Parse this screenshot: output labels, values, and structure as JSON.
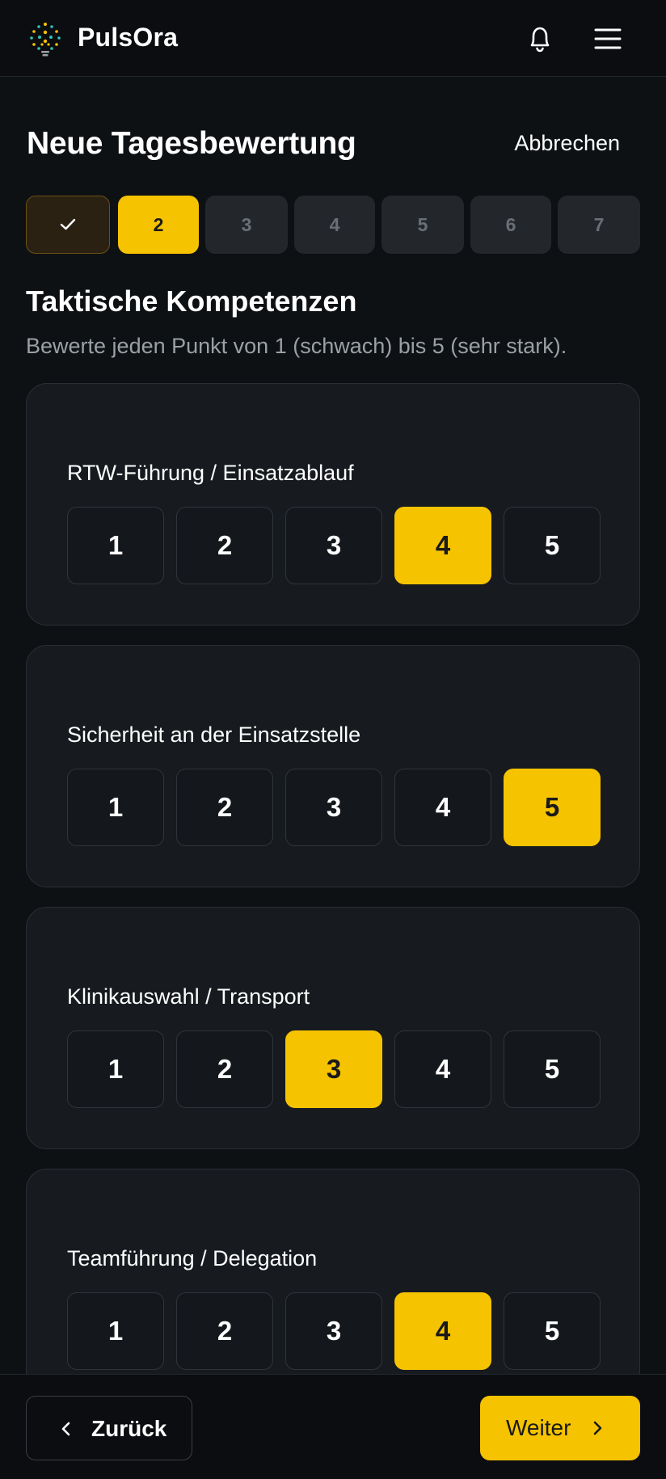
{
  "header": {
    "app_name": "PulsOra"
  },
  "page": {
    "title": "Neue Tagesbewertung",
    "cancel_label": "Abbrechen"
  },
  "stepper": {
    "current": 2,
    "steps": [
      {
        "label": "",
        "state": "done",
        "icon": "check-icon"
      },
      {
        "label": "2",
        "state": "active"
      },
      {
        "label": "3",
        "state": "todo"
      },
      {
        "label": "4",
        "state": "todo"
      },
      {
        "label": "5",
        "state": "todo"
      },
      {
        "label": "6",
        "state": "todo"
      },
      {
        "label": "7",
        "state": "todo"
      }
    ]
  },
  "section": {
    "title": "Taktische Kompetenzen",
    "subtitle": "Bewerte jeden Punkt von 1 (schwach) bis 5 (sehr stark)."
  },
  "criteria": [
    {
      "label": "RTW-Führung / Einsatzablauf",
      "selected": 4
    },
    {
      "label": "Sicherheit an der Einsatzstelle",
      "selected": 5
    },
    {
      "label": "Klinikauswahl / Transport",
      "selected": 3
    },
    {
      "label": "Teamführung / Delegation",
      "selected": 4
    }
  ],
  "rating_options": [
    "1",
    "2",
    "3",
    "4",
    "5"
  ],
  "footer": {
    "back_label": "Zurück",
    "next_label": "Weiter"
  },
  "colors": {
    "accent": "#f5c300",
    "background": "#0e1114",
    "card": "#171b1f"
  }
}
